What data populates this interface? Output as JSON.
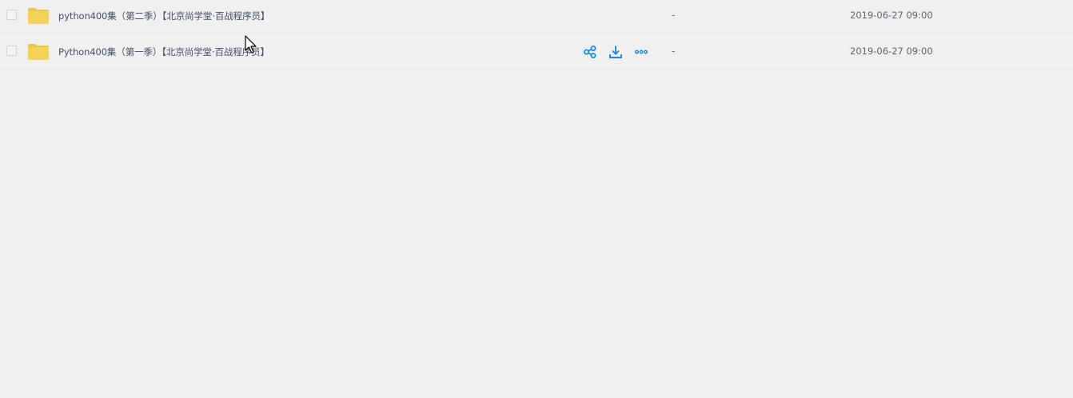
{
  "files": [
    {
      "name": "python400集（第二季）【北京尚学堂·百战程序员】",
      "size": "-",
      "date": "2019-06-27 09:00",
      "icon": "folder-icon"
    },
    {
      "name": "Python400集（第一季）【北京尚学堂·百战程序员】",
      "size": "-",
      "date": "2019-06-27 09:00",
      "icon": "folder-icon"
    }
  ],
  "row_actions": [
    "share-icon",
    "download-icon",
    "more-icon"
  ],
  "colors": {
    "background": "#f0f0f0",
    "folder": "#f5d35a",
    "folder_tab": "#e8c54b",
    "action": "#1a8bd6",
    "divider": "#dbe6f2"
  }
}
